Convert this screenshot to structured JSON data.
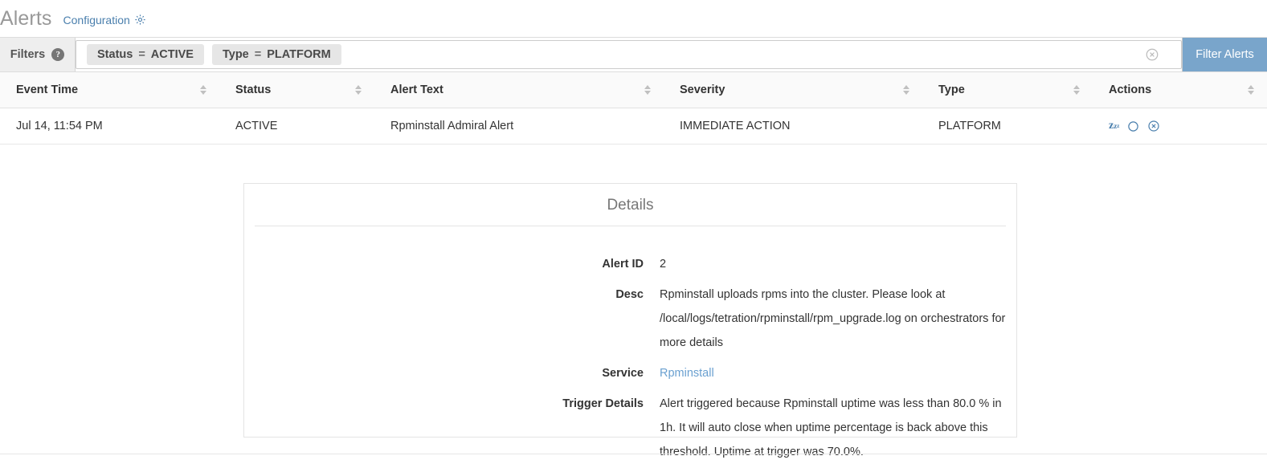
{
  "header": {
    "title": "Alerts",
    "configuration_label": "Configuration",
    "gear_icon": "gear-icon"
  },
  "filters": {
    "label": "Filters",
    "help_icon": "help-icon",
    "help_glyph": "?",
    "chips": [
      {
        "field": "Status",
        "operator": "=",
        "value": "ACTIVE"
      },
      {
        "field": "Type",
        "operator": "=",
        "value": "PLATFORM"
      }
    ],
    "input_placeholder": "",
    "input_value": "",
    "clear_icon": "clear-circle-x-icon",
    "submit_label": "Filter Alerts",
    "submit_color": "#79a5cb"
  },
  "table": {
    "columns": [
      {
        "label": "Event Time",
        "sort_icon": "sort-updown-icon"
      },
      {
        "label": "Status",
        "sort_icon": "sort-updown-icon"
      },
      {
        "label": "Alert Text",
        "sort_icon": "sort-updown-icon"
      },
      {
        "label": "Severity",
        "sort_icon": "sort-updown-icon"
      },
      {
        "label": "Type",
        "sort_icon": "sort-updown-icon"
      },
      {
        "label": "Actions",
        "sort_icon": "sort-updown-icon"
      }
    ],
    "rows": [
      {
        "event_time": "Jul 14, 11:54 PM",
        "status": "ACTIVE",
        "alert_text": "Rpminstall Admiral Alert",
        "severity": "IMMEDIATE ACTION",
        "type": "PLATFORM",
        "actions": [
          {
            "icon": "snooze-icon",
            "glyph": "z"
          },
          {
            "icon": "circle-icon",
            "glyph": "○"
          },
          {
            "icon": "close-circle-icon",
            "glyph": "⊗"
          }
        ]
      }
    ]
  },
  "details": {
    "title": "Details",
    "fields": [
      {
        "label": "Alert ID",
        "value": "2",
        "is_link": false
      },
      {
        "label": "Desc",
        "value": "Rpminstall uploads rpms into the cluster. Please look at /local/logs/tetration/rpminstall/rpm_upgrade.log on orchestrators for more details",
        "is_link": false
      },
      {
        "label": "Service",
        "value": "Rpminstall",
        "is_link": true
      },
      {
        "label": "Trigger Details",
        "value": "Alert triggered because Rpminstall uptime was less than 80.0 % in 1h. It will auto close when uptime percentage is back above this threshold. Uptime at trigger was 70.0%.",
        "is_link": false
      }
    ]
  },
  "colors": {
    "link": "#4a7fad",
    "accent": "#79a5cb",
    "title": "#999999"
  }
}
